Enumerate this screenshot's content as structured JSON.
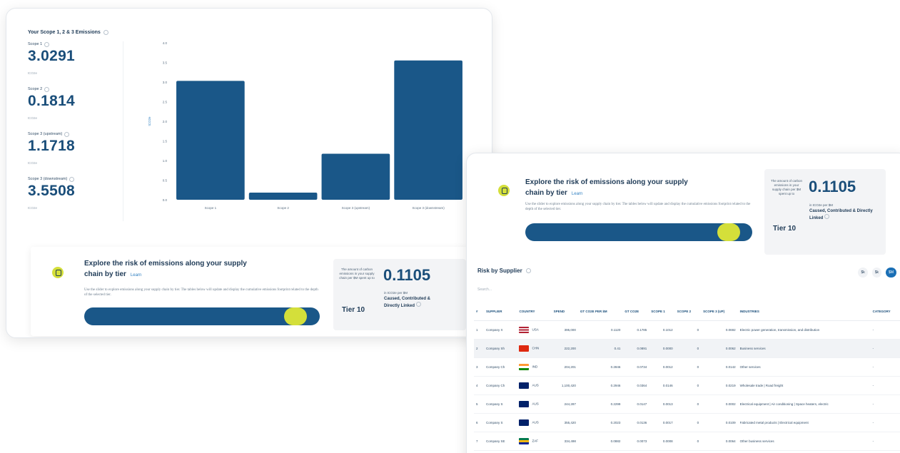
{
  "colors": {
    "bar": "#1a5788",
    "accent": "#d4df3a",
    "link": "#2f7fc1",
    "value": "#1a4e7a"
  },
  "card1": {
    "header": "Your Scope 1, 2 & 3 Emissions",
    "metrics": [
      {
        "label": "Scope 1",
        "value": "3.0291",
        "unit": "tCO2e"
      },
      {
        "label": "Scope 2",
        "value": "0.1814",
        "unit": "tCO2e"
      },
      {
        "label": "Scope 3 (upstream)",
        "value": "1.1718",
        "unit": "tCO2e"
      },
      {
        "label": "Scope 3 (downstream)",
        "value": "3.5508",
        "unit": "tCO2e"
      }
    ],
    "explore": {
      "title_line1": "Explore the risk of emissions along your supply",
      "title_line2": "chain by tier",
      "link": "Learn",
      "desc": "Use the slider to explore emissions along your supply chain by tier. The tables below will update and display the cumulative emissions footprint related to the depth of the selected tier.",
      "slider_fraction": 0.94,
      "tier_text": "The amount of carbon emissions in your supply chain per $M spent up to",
      "tier_label": "Tier 10",
      "tier_value": "0.1105",
      "tier_unit": "in tCO2e per $M",
      "tier_cause": "Caused, Contributed & Directly Linked"
    }
  },
  "chart_data": {
    "type": "bar",
    "categories": [
      "Scope 1",
      "Scope 2",
      "Scope 3 (upstream)",
      "Scope 3 (downstream)"
    ],
    "values": [
      3.0291,
      0.1814,
      1.1718,
      3.5508
    ],
    "ylabel": "tCO2e",
    "ylim": [
      0,
      4.0
    ],
    "yticks": [
      "0.0",
      "0.5",
      "1.0",
      "1.5",
      "2.0",
      "2.5",
      "3.0",
      "3.5",
      "4.0"
    ],
    "grid": false
  },
  "card2": {
    "explore": {
      "title_line1": "Explore the risk of emissions along your supply",
      "title_line2": "chain by tier",
      "link": "Learn",
      "desc": "Use the slider to explore emissions along your supply chain by tier. The tables below will update and display the cumulative emissions footprint related to the depth of the selected tier.",
      "slider_fraction": 0.94,
      "tier_text": "The amount of carbon emissions in your supply chain per $M spent up to",
      "tier_label": "Tier 10",
      "tier_value": "0.1105",
      "tier_unit": "in tCO2e per $M",
      "tier_cause": "Caused, Contributed & Directly Linked"
    },
    "risk_title": "Risk by Supplier",
    "search_placeholder": "Search...",
    "toggles": [
      "$k",
      "$k",
      "$M"
    ],
    "columns": [
      "#",
      "SUPPLIER",
      "COUNTRY",
      "SPEND",
      "GT CO2E PER $M",
      "GT CO2E",
      "SCOPE 1",
      "SCOPE 2",
      "SCOPE 3 (UP)",
      "INDUSTRIES",
      "CATEGORY"
    ],
    "rows": [
      {
        "n": "1",
        "supplier": "Company X",
        "country": "USA",
        "flag": "us",
        "spend": "395,000",
        "a": "0.1120",
        "b": "0.1785",
        "c": "0.1012",
        "d": "0",
        "e": "0.0692",
        "industries": "Electric power generation, transmission, and distribution",
        "category": "-"
      },
      {
        "n": "2",
        "supplier": "Company Sh",
        "country": "CHN",
        "flag": "cn",
        "spend": "222,200",
        "a": "0.41",
        "b": "0.0891",
        "c": "0.0000",
        "d": "0",
        "e": "0.0062",
        "industries": "Business services",
        "category": "-"
      },
      {
        "n": "3",
        "supplier": "Company Ch",
        "country": "IND",
        "flag": "in",
        "spend": "204,201",
        "a": "0.2846",
        "b": "0.0734",
        "c": "0.0012",
        "d": "0",
        "e": "0.0142",
        "industries": "Other services",
        "category": "-"
      },
      {
        "n": "4",
        "supplier": "Company Ch",
        "country": "AUS",
        "flag": "au",
        "spend": "1,100,420",
        "a": "0.2946",
        "b": "0.0364",
        "c": "0.0146",
        "d": "0",
        "e": "0.0219",
        "industries": "Wholesale trade | Road freight",
        "category": "-"
      },
      {
        "n": "5",
        "supplier": "Company S",
        "country": "AUS",
        "flag": "au",
        "spend": "244,287",
        "a": "0.2299",
        "b": "0.0147",
        "c": "0.0013",
        "d": "0",
        "e": "0.0002",
        "industries": "Electrical equipment | Air conditioning | Space heaters, electric",
        "category": "-"
      },
      {
        "n": "6",
        "supplier": "Company S",
        "country": "AUS",
        "flag": "au",
        "spend": "355,420",
        "a": "0.2023",
        "b": "0.0136",
        "c": "0.0017",
        "d": "0",
        "e": "0.0109",
        "industries": "Fabricated metal products | Electrical equipment",
        "category": "-"
      },
      {
        "n": "7",
        "supplier": "Company SE",
        "country": "ZAF",
        "flag": "za",
        "spend": "334,498",
        "a": "0.0882",
        "b": "0.0073",
        "c": "0.0008",
        "d": "0",
        "e": "0.0064",
        "industries": "Other business services",
        "category": "-"
      }
    ]
  }
}
